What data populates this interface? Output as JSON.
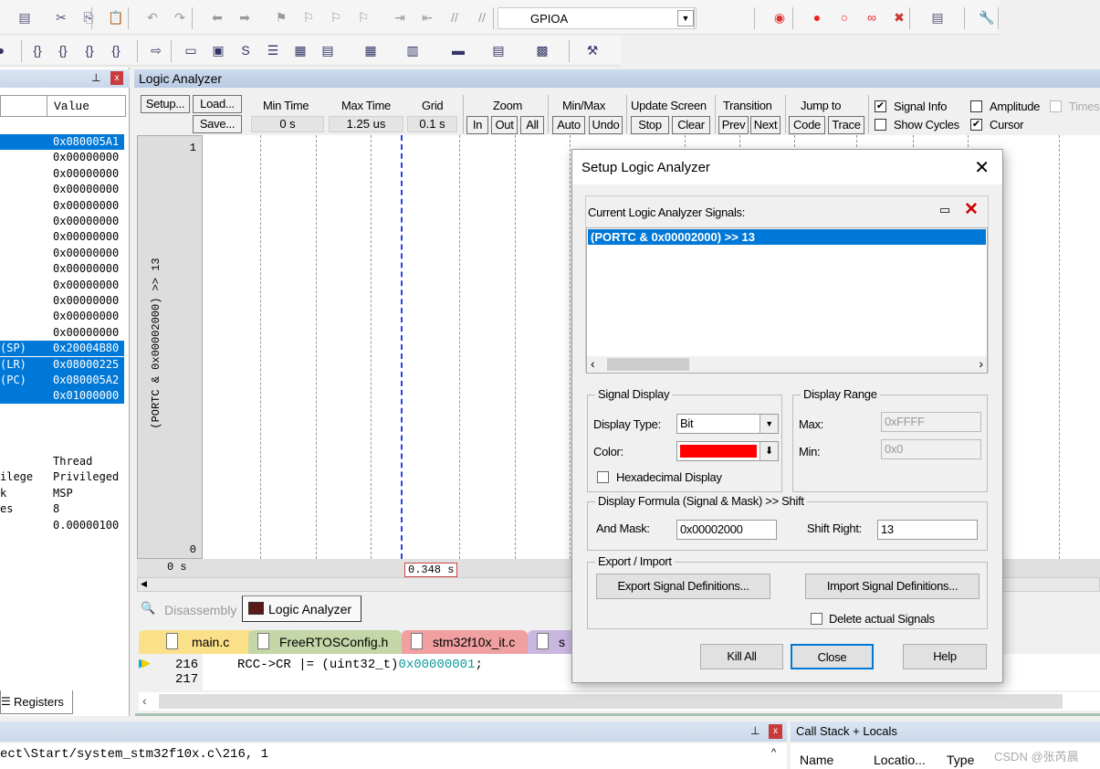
{
  "toolbar": {
    "target_combo": "GPIOA",
    "row1_icons": [
      "batch-build-icon",
      "cut-icon",
      "copy-icon",
      "paste-icon",
      "undo-icon",
      "redo-icon",
      "back-icon",
      "forward-icon",
      "bookmark-icon",
      "prev-bookmark-icon",
      "next-bookmark-icon",
      "clear-bookmarks-icon",
      "indent-icon",
      "unindent-icon",
      "comment-icon",
      "uncomment-icon",
      "find-in-files-icon"
    ],
    "row2_icons": [
      "reset-icon",
      "step-into-icon",
      "step-over-icon",
      "step-out-icon",
      "run-to-cursor-icon",
      "show-next-statement-icon",
      "command-window-icon",
      "disassembly-window-icon",
      "symbols-window-icon",
      "registers-window-icon",
      "call-stack-icon",
      "watch-window-icon",
      "memory-window-icon",
      "serial-window-icon",
      "analysis-window-icon",
      "trace-window-icon",
      "system-viewer-icon",
      "toolbox-icon"
    ]
  },
  "registers_panel": {
    "column_value": "Value",
    "rows": [
      {
        "name": "",
        "value": "0x080005A1",
        "selected": true
      },
      {
        "name": "",
        "value": "0x00000000",
        "selected": false
      },
      {
        "name": "",
        "value": "0x00000000",
        "selected": false
      },
      {
        "name": "",
        "value": "0x00000000",
        "selected": false
      },
      {
        "name": "",
        "value": "0x00000000",
        "selected": false
      },
      {
        "name": "",
        "value": "0x00000000",
        "selected": false
      },
      {
        "name": "",
        "value": "0x00000000",
        "selected": false
      },
      {
        "name": "",
        "value": "0x00000000",
        "selected": false
      },
      {
        "name": "",
        "value": "0x00000000",
        "selected": false
      },
      {
        "name": "",
        "value": "0x00000000",
        "selected": false
      },
      {
        "name": "",
        "value": "0x00000000",
        "selected": false
      },
      {
        "name": "",
        "value": "0x00000000",
        "selected": false
      },
      {
        "name": "",
        "value": "0x00000000",
        "selected": false
      },
      {
        "name": "(SP)",
        "value": "0x20004B80",
        "selected": true
      },
      {
        "name": "(LR)",
        "value": "0x08000225",
        "selected": true
      },
      {
        "name": "(PC)",
        "value": "0x080005A2",
        "selected": true
      },
      {
        "name": "",
        "value": "0x01000000",
        "selected": true
      }
    ],
    "internal": [
      {
        "name": "",
        "value": "Thread"
      },
      {
        "name": "ilege",
        "value": "Privileged"
      },
      {
        "name": "k",
        "value": "MSP"
      },
      {
        "name": "es",
        "value": "8"
      },
      {
        "name": "",
        "value": "0.00000100"
      }
    ],
    "tab_label": "Registers"
  },
  "logic_analyzer": {
    "title": "Logic Analyzer",
    "setup": "Setup...",
    "load": "Load...",
    "save": "Save...",
    "min_time_label": "Min Time",
    "min_time": "0 s",
    "max_time_label": "Max Time",
    "max_time": "1.25 us",
    "grid_label": "Grid",
    "grid": "0.1 s",
    "zoom_label": "Zoom",
    "zoom_in": "In",
    "zoom_out": "Out",
    "zoom_all": "All",
    "minmax_label": "Min/Max",
    "auto": "Auto",
    "undo": "Undo",
    "update_label": "Update Screen",
    "stop": "Stop",
    "clear": "Clear",
    "transition_label": "Transition",
    "prev": "Prev",
    "next": "Next",
    "jump_label": "Jump to",
    "code": "Code",
    "trace": "Trace",
    "signal_info": {
      "label": "Signal Info",
      "checked": true
    },
    "show_cycles": {
      "label": "Show Cycles",
      "checked": false
    },
    "amplitude": {
      "label": "Amplitude",
      "checked": false
    },
    "cursor": {
      "label": "Cursor",
      "checked": true
    },
    "timestamps": {
      "label": "Times",
      "checked": false
    },
    "signal_name": "(PORTC & 0x00002000) >> 13",
    "y_max": "1",
    "y_min": "0",
    "axis_start": "0 s",
    "cursor_time": "0.348 s"
  },
  "bottom_tabs": [
    {
      "label": "Disassembly",
      "active": false
    },
    {
      "label": "Logic Analyzer",
      "active": true
    }
  ],
  "file_tabs": [
    {
      "label": "main.c",
      "color": "#fbe08a"
    },
    {
      "label": "FreeRTOSConfig.h",
      "color": "#c5d6a8"
    },
    {
      "label": "stm32f10x_it.c",
      "color": "#f0a0a0"
    },
    {
      "label": "s",
      "color": "#c9b7e0"
    }
  ],
  "editor": {
    "lines": [
      {
        "num": "216",
        "code": "RCC->CR |= (uint32_t)",
        "hex": "0x00000001",
        "end": ";"
      },
      {
        "num": "217",
        "code": "",
        "hex": "",
        "end": ""
      }
    ]
  },
  "command": {
    "line1": "ect\\Start/system_stm32f10x.c\\216, 1"
  },
  "callstack": {
    "title": "Call Stack + Locals",
    "columns": [
      "Name",
      "Locatio...",
      "Type"
    ]
  },
  "watermark": "CSDN @张芮晨",
  "dialog": {
    "title": "Setup Logic Analyzer",
    "signals_label": "Current Logic Analyzer Signals:",
    "signals": [
      "(PORTC & 0x00002000) >> 13"
    ],
    "signal_display": "Signal Display",
    "display_type_label": "Display Type:",
    "display_type": "Bit",
    "color_label": "Color:",
    "color": "#ff0000",
    "hex_display": {
      "label": "Hexadecimal Display",
      "checked": false
    },
    "display_range": "Display Range",
    "max_label": "Max:",
    "max": "0xFFFF",
    "min_label": "Min:",
    "min": "0x0",
    "formula": "Display Formula (Signal & Mask) >> Shift",
    "and_mask_label": "And Mask:",
    "and_mask": "0x00002000",
    "shift_label": "Shift Right:",
    "shift": "13",
    "export_import": "Export / Import",
    "export_btn": "Export Signal Definitions...",
    "import_btn": "Import Signal Definitions...",
    "delete_actual": {
      "label": "Delete actual Signals",
      "checked": false
    },
    "kill_all": "Kill All",
    "close": "Close",
    "help": "Help"
  }
}
